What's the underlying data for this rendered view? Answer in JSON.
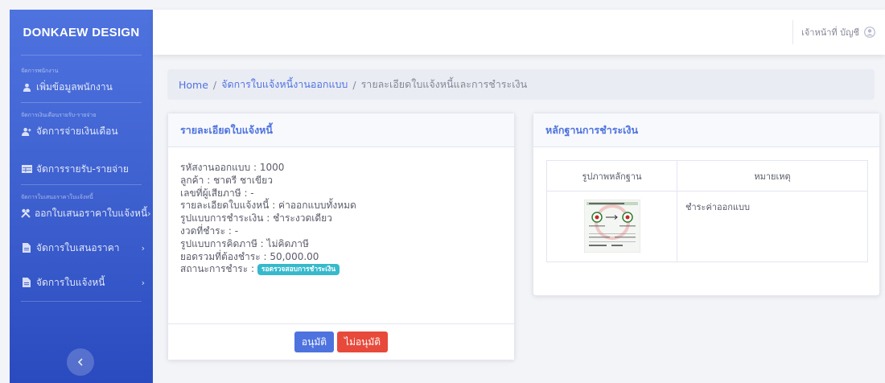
{
  "brand": "DONKAEW DESIGN",
  "sidebar": {
    "sections": [
      {
        "heading": "จัดการพนักงาน",
        "items": [
          {
            "label": "เพิ่มข้อมูลพนักงาน",
            "icon": "user-icon"
          }
        ]
      },
      {
        "heading": "จัดการเงินเดือนรายรับ-รายจ่าย",
        "items": [
          {
            "label": "จัดการจ่ายเงินเดือน",
            "icon": "user-plus-icon"
          },
          {
            "label": "จัดการรายรับ-รายจ่าย",
            "icon": "table-icon"
          }
        ]
      },
      {
        "heading": "จัดการใบเสนอราคาใบแจ้งหนี้",
        "items": [
          {
            "label": "ออกใบเสนอราคาใบแจ้งหนี้",
            "icon": "tools-icon"
          },
          {
            "label": "จัดการใบเสนอราคา",
            "icon": "document-icon"
          },
          {
            "label": "จัดการใบแจ้งหนี้",
            "icon": "document-icon"
          }
        ]
      }
    ],
    "toggle_icon": "chevron-left-icon"
  },
  "topbar": {
    "user_name": "เจ้าหน้าที่ บัญชี",
    "avatar_icon": "user-circle-icon"
  },
  "breadcrumb": {
    "home": "Home",
    "separator": "/",
    "level1": "จัดการใบแจ้งหนี้งานออกแบบ",
    "current": "รายละเอียดใบแจ้งหนี้และการชำระเงิน"
  },
  "invoice": {
    "title": "รายละเอียดใบแจ้งหนี้",
    "rows": [
      {
        "label": "รหัสงานออกแบบ",
        "value": "1000"
      },
      {
        "label": "ลูกค้า",
        "value": "ชาตรี ชาเขียว"
      },
      {
        "label": "เลขที่ผู้เสียภาษี",
        "value": "-"
      },
      {
        "label": "รายละเอียดใบแจ้งหนี้",
        "value": "ค่าออกแบบทั้งหมด"
      },
      {
        "label": "รูปแบบการชำระเงิน",
        "value": "ชำระงวดเดียว"
      },
      {
        "label": "งวดที่ชำระ",
        "value": "-"
      },
      {
        "label": "รูปแบบการคิดภาษี",
        "value": "ไม่คิดภาษี"
      },
      {
        "label": "ยอดรวมที่ต้องชำระ",
        "value": "50,000.00"
      }
    ],
    "status_label": "สถานะการชำระ",
    "status_badge": "รอตรวจสอบการชำระเงิน",
    "status_color": "#36b9cc",
    "approve_label": "อนุมัติ",
    "reject_label": "ไม่อนุมัติ"
  },
  "proof": {
    "title": "หลักฐานการชำระเงิน",
    "columns": [
      "รูปภาพหลักฐาน",
      "หมายเหตุ"
    ],
    "rows": [
      {
        "image": "payment-slip-thumbnail",
        "note": "ชำระค่าออกแบบ"
      }
    ]
  },
  "colors": {
    "primary": "#4e73df",
    "danger": "#e74a3b",
    "info": "#36b9cc"
  }
}
